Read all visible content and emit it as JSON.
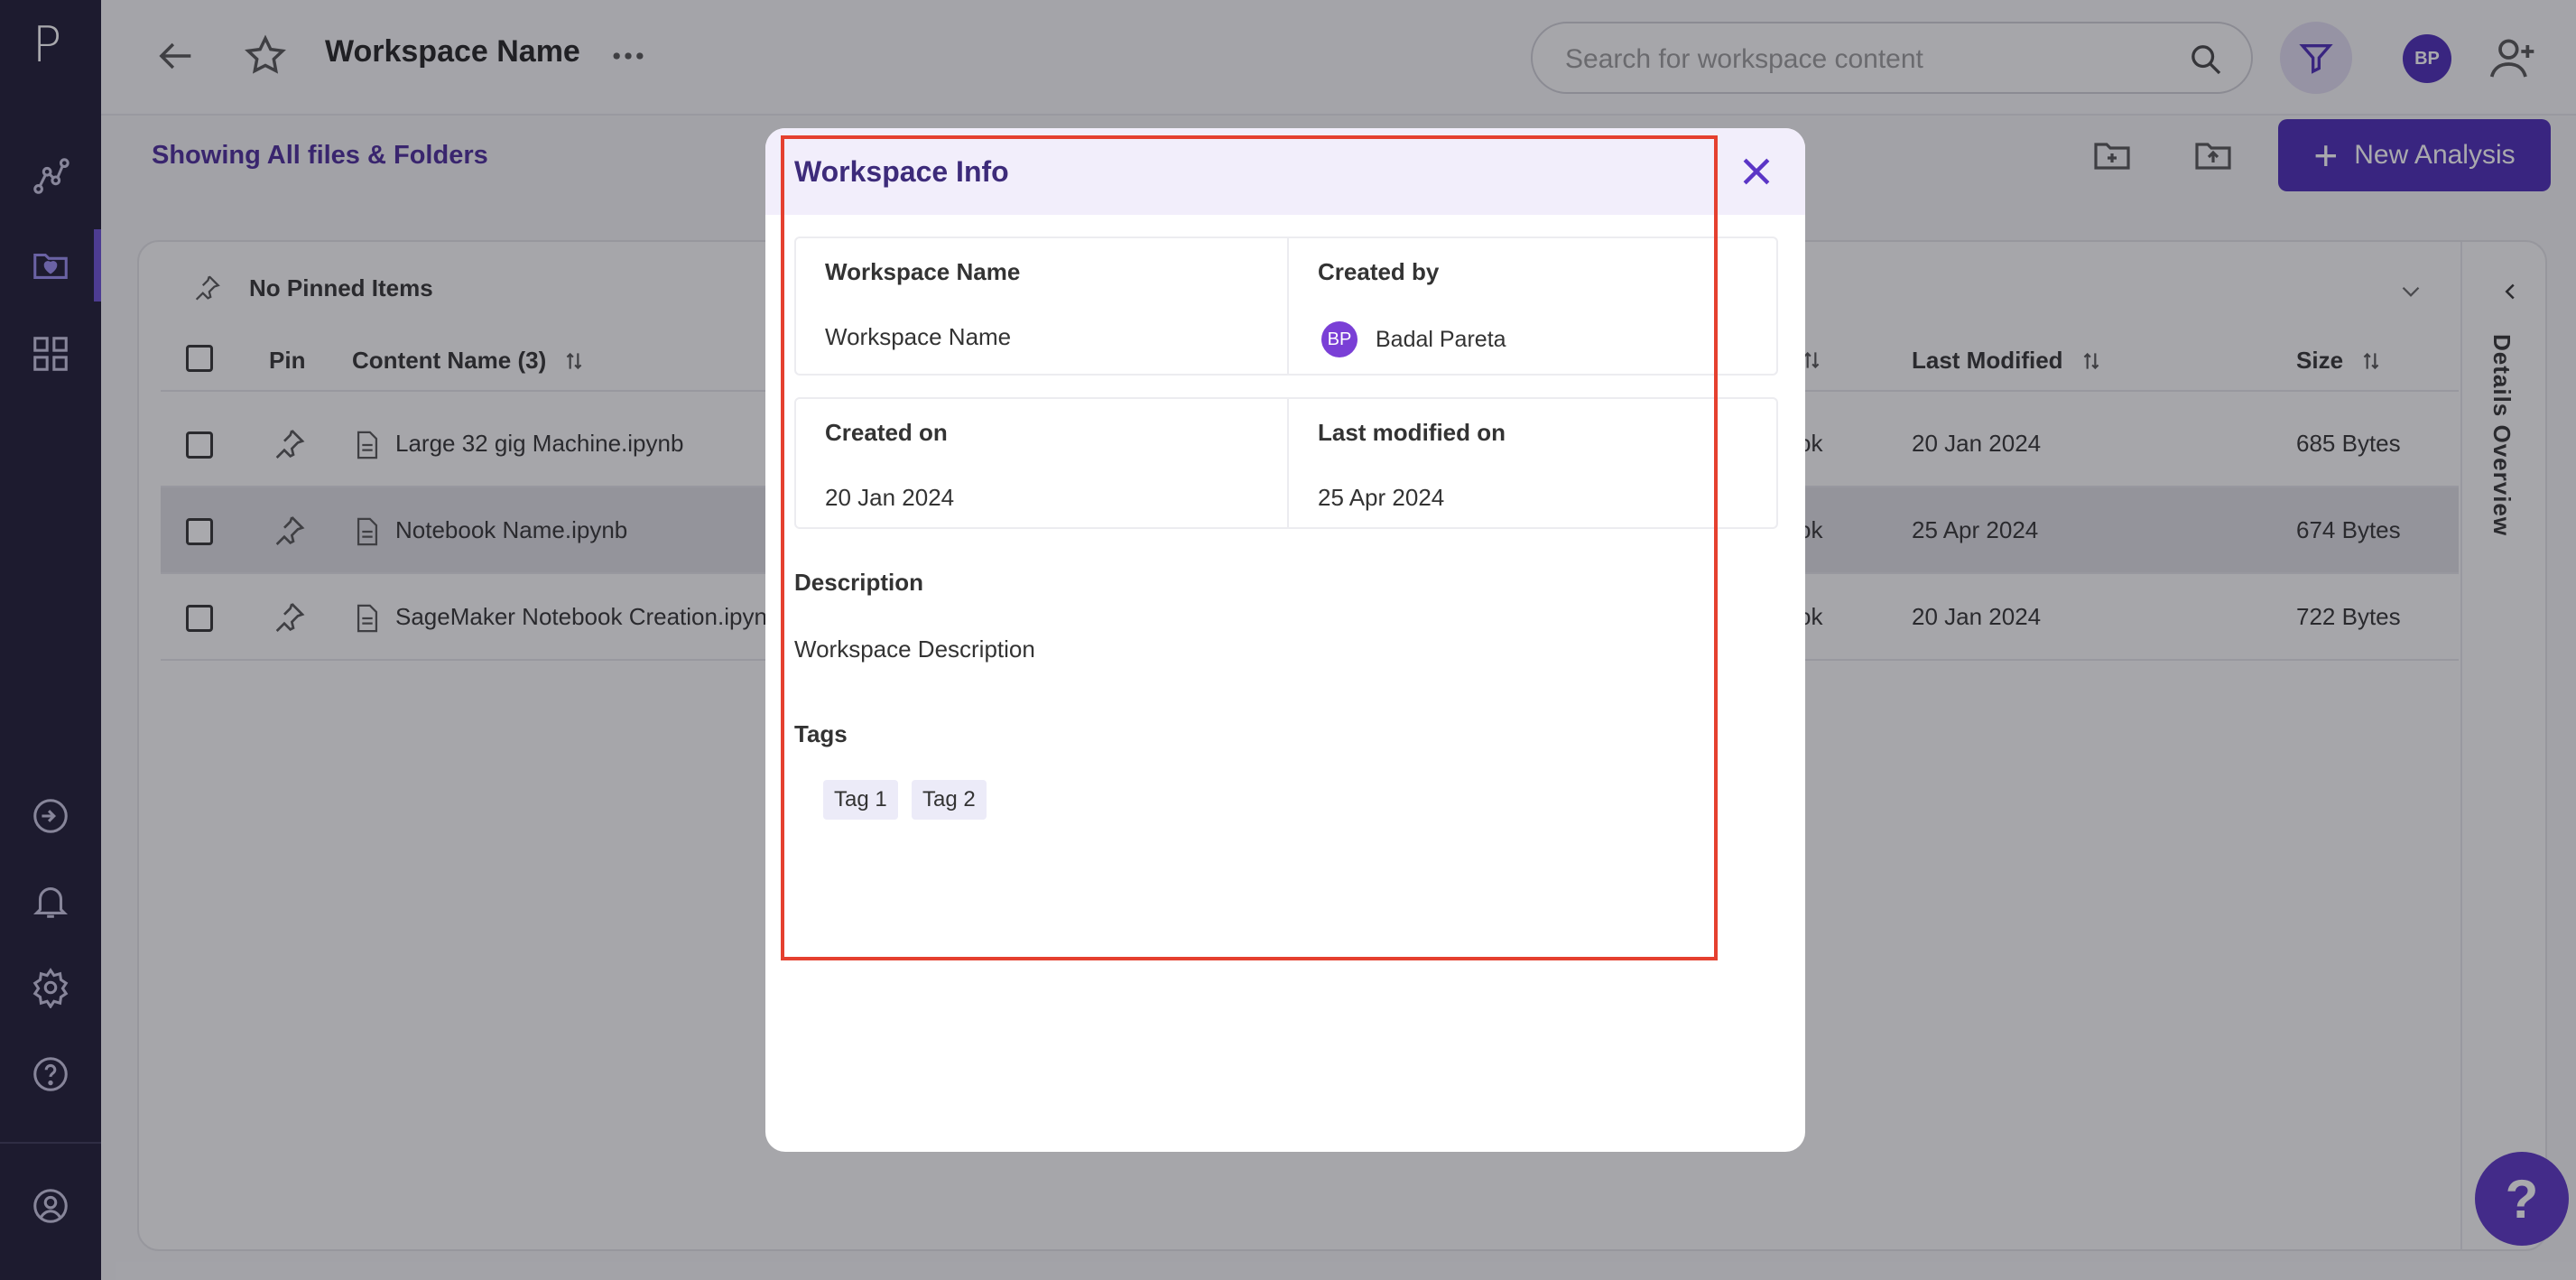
{
  "app": {
    "logo": "P",
    "sidebar_icons": [
      "analytics-icon",
      "workspace-icon",
      "apps-grid-icon",
      "integrations-icon",
      "bell-icon",
      "settings-icon",
      "help-circle-icon",
      "account-icon"
    ]
  },
  "header": {
    "title": "Workspace Name",
    "search_placeholder": "Search for workspace content",
    "avatar_initials": "BP"
  },
  "subheader": {
    "showing": "Showing All files & Folders",
    "new_analysis": "New Analysis"
  },
  "content": {
    "pinned_label": "No Pinned Items",
    "details_overview": "Details Overview",
    "columns": {
      "pin": "Pin",
      "name": "Content Name (3)",
      "last_modified": "Last Modified",
      "size": "Size"
    },
    "rows": [
      {
        "name": "Large 32 gig Machine.ipynb",
        "type_fragment": "ok",
        "modified": "20 Jan 2024",
        "size": "685 Bytes"
      },
      {
        "name": "Notebook Name.ipynb",
        "type_fragment": "ok",
        "modified": "25 Apr 2024",
        "size": "674 Bytes"
      },
      {
        "name": "SageMaker Notebook Creation.ipyn",
        "type_fragment": "ok",
        "modified": "20 Jan 2024",
        "size": "722 Bytes"
      }
    ]
  },
  "modal": {
    "title": "Workspace Info",
    "workspace_name_label": "Workspace Name",
    "workspace_name": "Workspace Name",
    "created_by_label": "Created by",
    "creator_initials": "BP",
    "creator_name": "Badal Pareta",
    "created_on_label": "Created on",
    "created_on": "20 Jan 2024",
    "last_modified_label": "Last modified on",
    "last_modified": "25 Apr 2024",
    "description_label": "Description",
    "description": "Workspace Description",
    "tags_label": "Tags",
    "tags": [
      "Tag 1",
      "Tag 2"
    ]
  },
  "help_button": "?",
  "colors": {
    "sidebar_bg": "#1d1b34",
    "brand_purple": "#4b2bb6",
    "modal_header_bg": "#f2eefb",
    "highlight_red": "#e5402f"
  }
}
